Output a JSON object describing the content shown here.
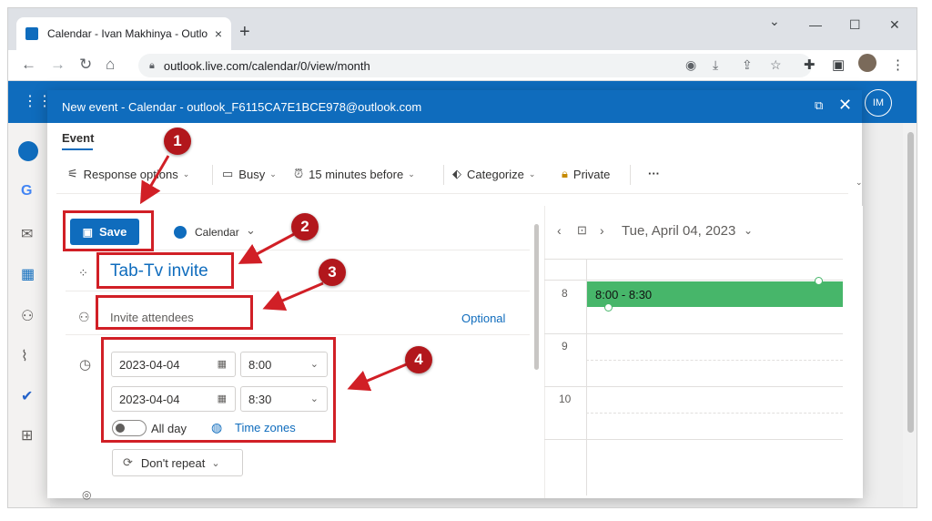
{
  "browser": {
    "tab_title": "Calendar - Ivan Makhinya - Outlo",
    "tab_close": "×",
    "new_tab": "+",
    "url": "outlook.live.com/calendar/0/view/month",
    "minimize": "—",
    "maximize": "☐",
    "close": "✕",
    "dropdown": "⌄"
  },
  "outlook": {
    "avatar_initials": "IM"
  },
  "dialog": {
    "title": "New event - Calendar - outlook_F6115CA7E1BCE978@outlook.com",
    "tab": "Event",
    "ribbon": {
      "response_options": "Response options",
      "busy": "Busy",
      "reminder": "15 minutes before",
      "categorize": "Categorize",
      "private": "Private",
      "more": "···"
    },
    "save_label": "Save",
    "calendar_label": "Calendar",
    "event_title": "Tab-Tv invite",
    "attendees_placeholder": "Invite attendees",
    "optional_label": "Optional",
    "start_date": "2023-04-04",
    "start_time": "8:00",
    "end_date": "2023-04-04",
    "end_time": "8:30",
    "all_day_label": "All day",
    "all_day": false,
    "time_zones_label": "Time zones",
    "repeat_label": "Don't repeat"
  },
  "day_view": {
    "date": "Tue, April 04, 2023",
    "hours": [
      "8",
      "9",
      "10"
    ],
    "event_label": "8:00 - 8:30",
    "event_color": "#47b66a"
  },
  "annotations": [
    "1",
    "2",
    "3",
    "4"
  ],
  "colors": {
    "accent": "#0f6cbd",
    "annotation_red": "#d11f26"
  }
}
